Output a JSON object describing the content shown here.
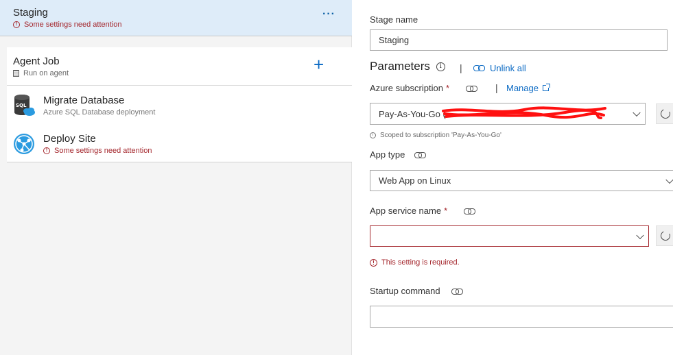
{
  "stage": {
    "title": "Staging",
    "warning": "Some settings need attention",
    "more_label": "···"
  },
  "agent_job": {
    "title": "Agent Job",
    "subtitle": "Run on agent",
    "add_label": "+"
  },
  "tasks": [
    {
      "title": "Migrate Database",
      "subtitle": "Azure SQL Database deployment",
      "icon": "sql-database-icon"
    },
    {
      "title": "Deploy Site",
      "subtitle": "Some settings need attention",
      "icon": "web-app-icon"
    }
  ],
  "form": {
    "stage_name_label": "Stage name",
    "stage_name_value": "Staging",
    "parameters_label": "Parameters",
    "unlink_all": "Unlink all",
    "azure_subscription_label": "Azure subscription",
    "manage_label": "Manage",
    "subscription_value": "Pay-As-You-Go (",
    "subscription_note": "Scoped to subscription 'Pay-As-You-Go'",
    "app_type_label": "App type",
    "app_type_value": "Web App on Linux",
    "app_service_label": "App service name",
    "app_service_value": "",
    "app_service_error": "This setting is required.",
    "startup_command_label": "Startup command",
    "startup_command_value": "",
    "required_mark": "*"
  },
  "colors": {
    "accent": "#0b6ac4",
    "error": "#a4262c",
    "selected_stage_bg": "#deecf9",
    "redaction": "#ff0000"
  }
}
